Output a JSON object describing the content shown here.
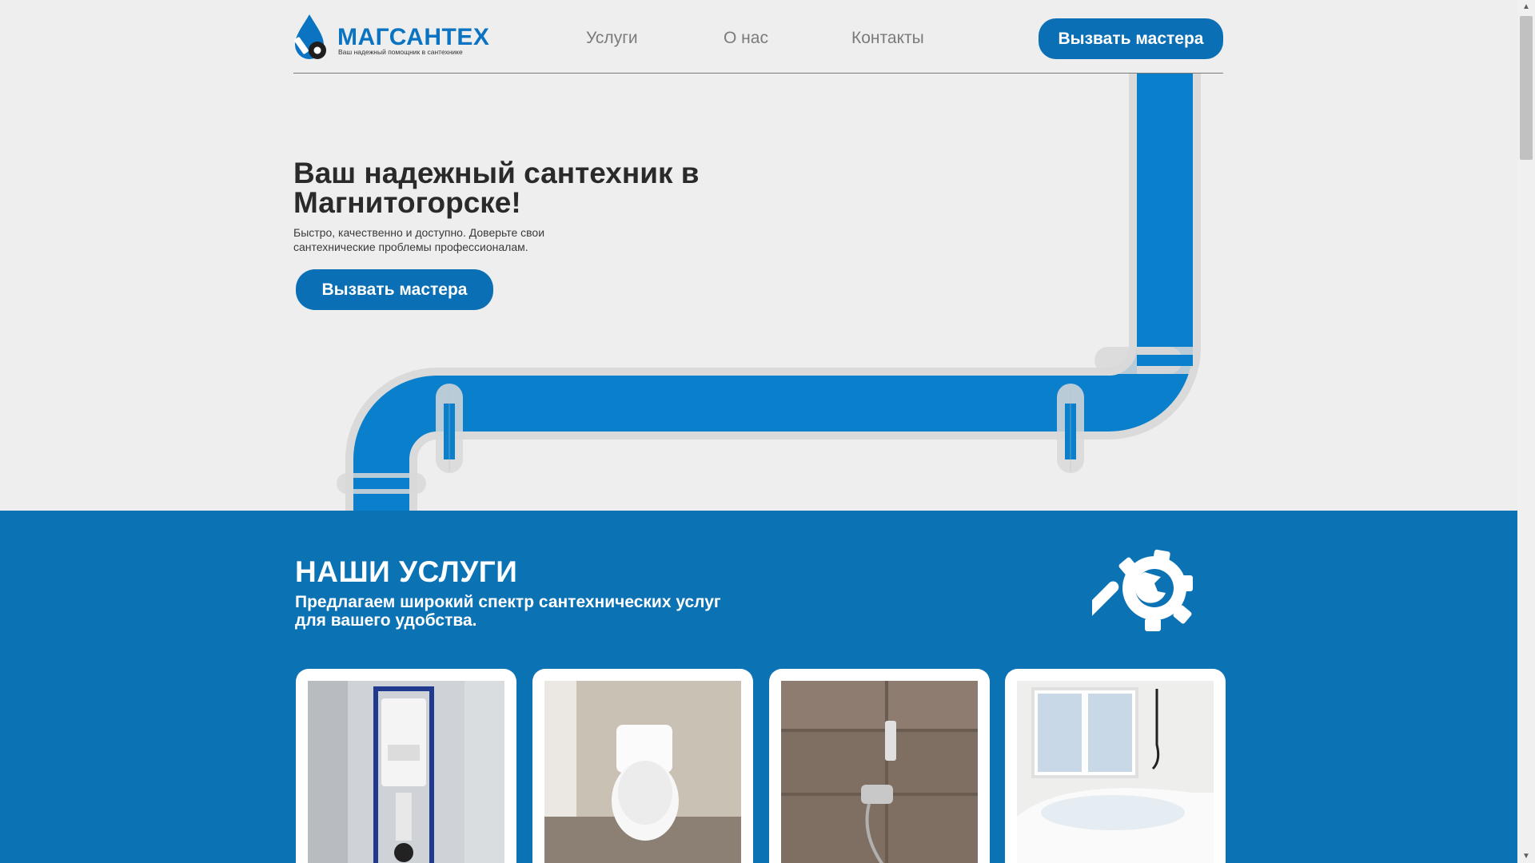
{
  "brand": {
    "name": "МАГСАНТЕХ",
    "tagline": "Ваш надежный помощник в сантехнике",
    "accent": "#0a6fb5"
  },
  "nav": {
    "services": "Услуги",
    "about": "О нас",
    "contacts": "Контакты",
    "cta": "Вызвать мастера"
  },
  "hero": {
    "title": "Ваш надежный сантехник в Магнитогорске!",
    "subtitle": "Быстро, качественно и доступно. Доверьте свои сантехнические проблемы профессионалам.",
    "cta": "Вызвать мастера"
  },
  "services": {
    "title": "НАШИ УСЛУГИ",
    "subtitle": "Предлагаем широкий спектр сантехнических услуг для вашего удобства.",
    "icon": "wrench-gear-icon",
    "cards": [
      {
        "photo": "installation-frame-photo"
      },
      {
        "photo": "toilet-photo"
      },
      {
        "photo": "hygienic-shower-photo"
      },
      {
        "photo": "bathtub-photo"
      }
    ]
  }
}
